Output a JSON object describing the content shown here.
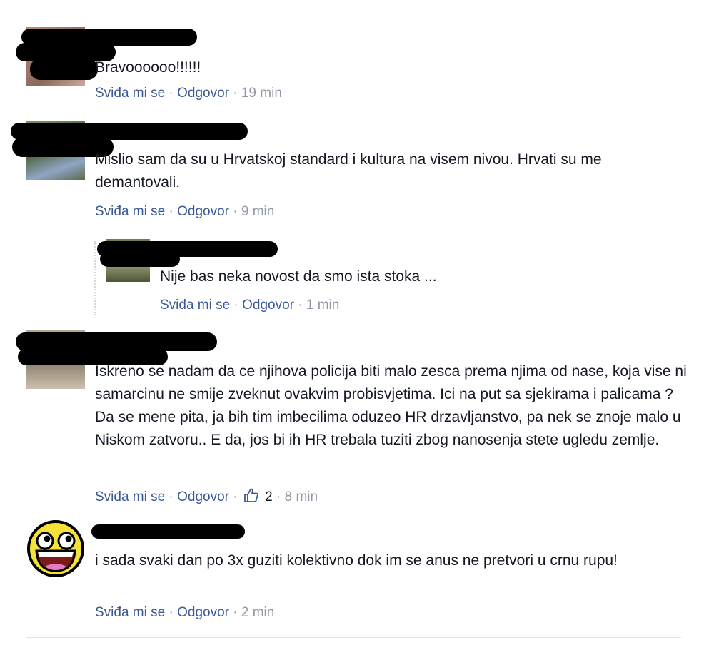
{
  "comments": [
    {
      "text": "Bravoooooo!!!!!!",
      "like_label": "Sviđa mi se",
      "reply_label": "Odgovor",
      "time": "19 min"
    },
    {
      "text": "Mislio sam da su u Hrvatskoj standard i kultura na visem nivou. Hrvati su me demantovali.",
      "like_label": "Sviđa mi se",
      "reply_label": "Odgovor",
      "time": "9 min"
    },
    {
      "text": "Nije bas neka novost da smo ista stoka ...",
      "like_label": "Sviđa mi se",
      "reply_label": "Odgovor",
      "time": "1 min"
    },
    {
      "text": "Iskreno se nadam da ce njihova policija biti malo zesca prema njima od nase, koja vise ni samarcinu ne smije zveknut ovakvim probisvjetima. Ici na put sa sjekirama i palicama ? Da se mene pita, ja bih tim imbecilima oduzeo HR drzavljanstvo, pa nek se znoje malo u Niskom zatvoru.. E da, jos bi ih HR trebala tuziti zbog nanosenja stete ugledu zemlje.",
      "like_label": "Sviđa mi se",
      "reply_label": "Odgovor",
      "like_count": "2",
      "time": "8 min"
    },
    {
      "text": "i sada svaki dan po 3x guziti kolektivno dok im se anus ne pretvori u crnu rupu!",
      "like_label": "Sviđa mi se",
      "reply_label": "Odgovor",
      "time": "2 min"
    }
  ],
  "separator": "·",
  "colors": {
    "link": "#3b5998",
    "meta": "#9197a3",
    "text": "#141823",
    "redaction": "#000000"
  },
  "icons": {
    "thumbs_up": "thumbs-up-icon",
    "avatar_5": "awesome-face-icon"
  }
}
